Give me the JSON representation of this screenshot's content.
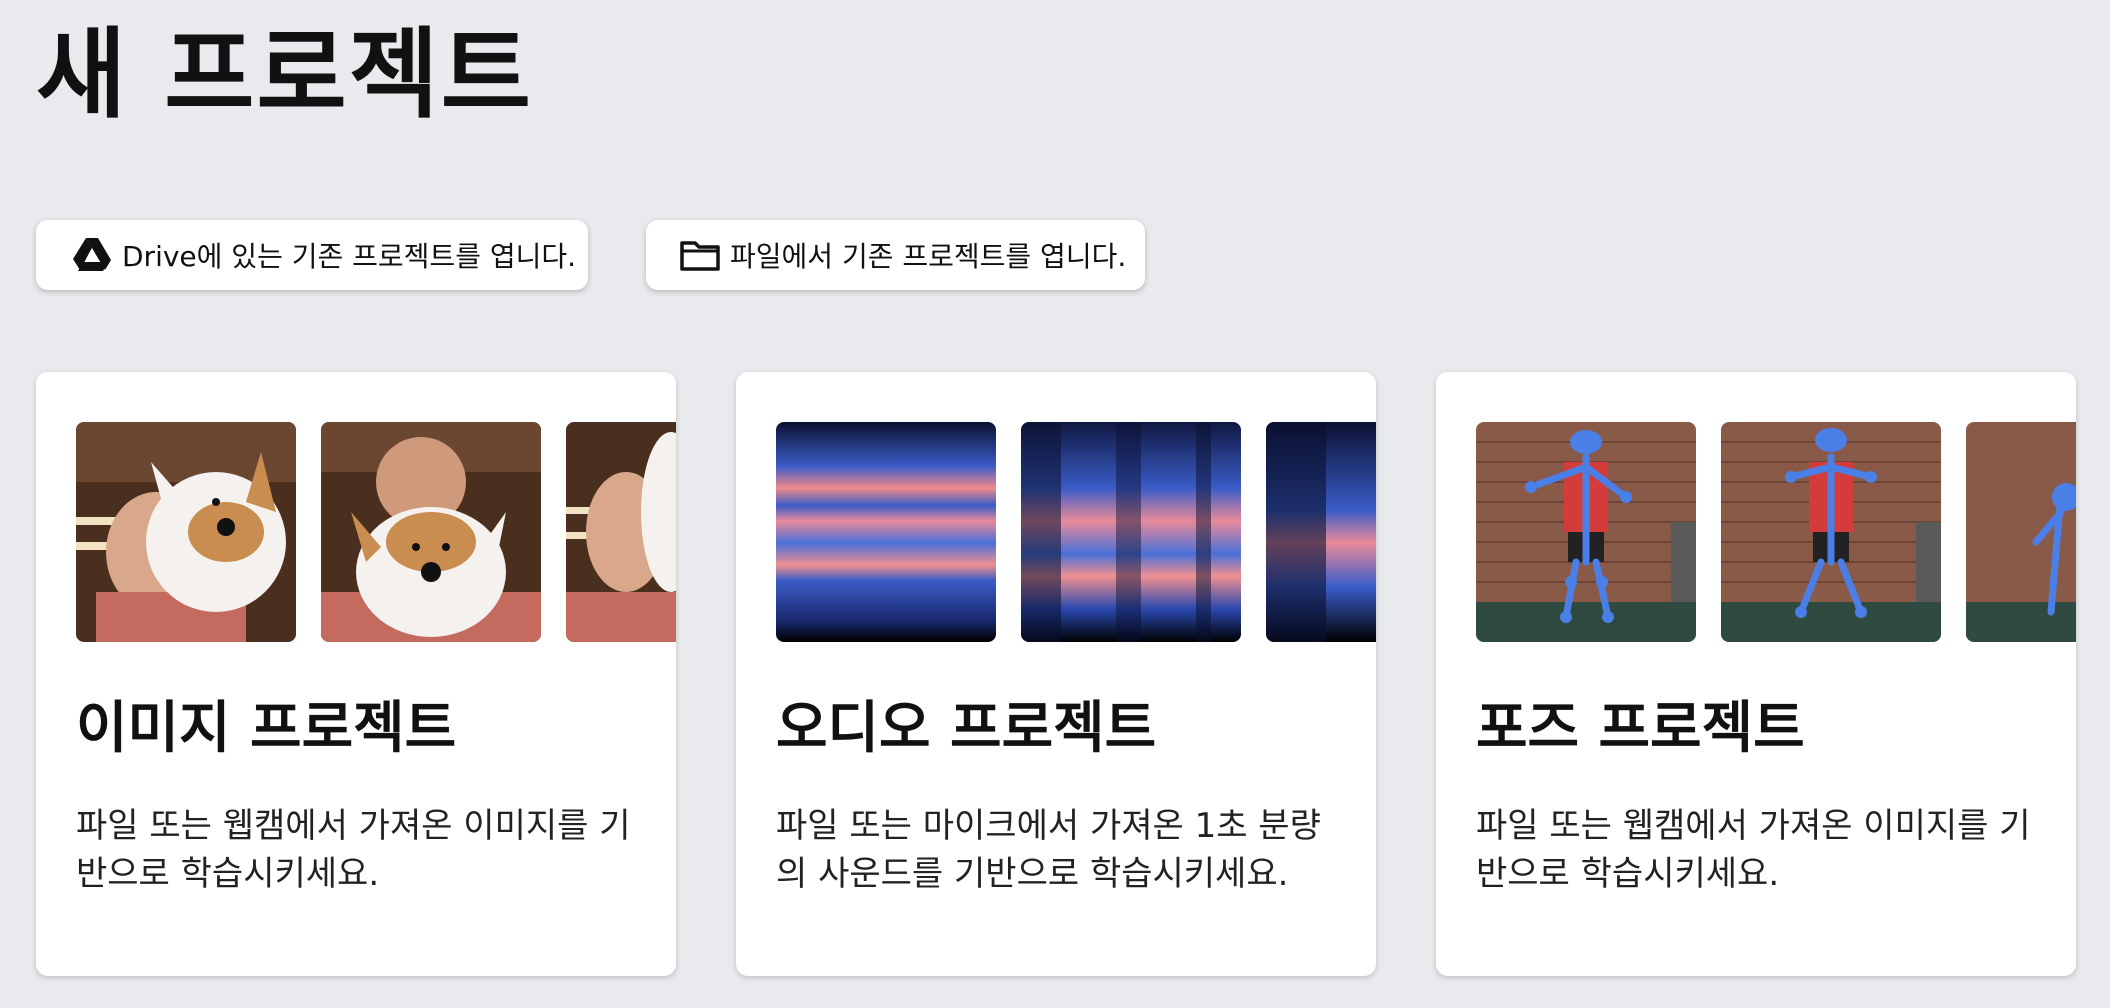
{
  "page": {
    "title": "새 프로젝트"
  },
  "open_buttons": {
    "drive": {
      "label": "Drive에 있는 기존 프로젝트를 엽니다.",
      "icon": "google-drive-icon"
    },
    "file": {
      "label": "파일에서 기존 프로젝트를 엽니다.",
      "icon": "folder-icon"
    }
  },
  "cards": {
    "image": {
      "title": "이미지 프로젝트",
      "description": "파일 또는 웹캠에서 가져온 이미지를 기반으로 학습시키세요."
    },
    "audio": {
      "title": "오디오 프로젝트",
      "description": "파일 또는 마이크에서 가져온 1초 분량의 사운드를 기반으로 학습시키세요."
    },
    "pose": {
      "title": "포즈 프로젝트",
      "description": "파일 또는 웹캠에서 가져온 이미지를 기반으로 학습시키세요."
    }
  },
  "colors": {
    "background": "#e8eaed",
    "card": "#ffffff",
    "skeleton": "#4a7fe8",
    "spectrogram_warm": "#f08a8a",
    "spectrogram_cool": "#3a5cc8"
  }
}
